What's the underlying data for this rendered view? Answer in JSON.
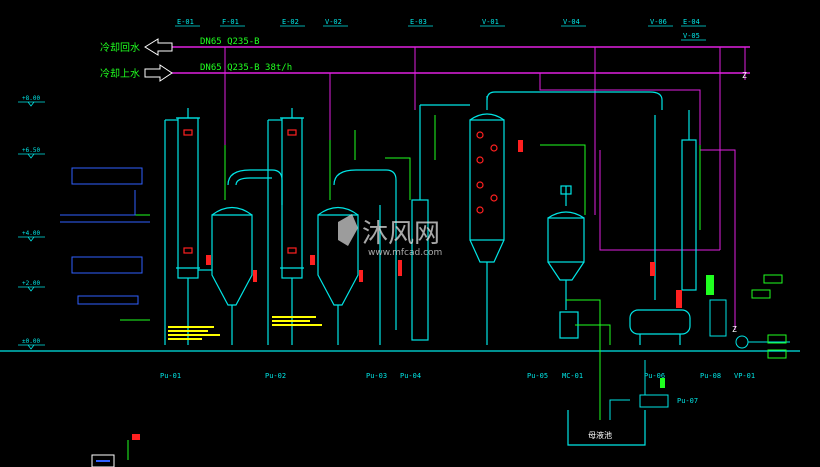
{
  "pipes": {
    "cooling_return": "冷却回水",
    "cooling_supply": "冷却上水",
    "return_spec": "DN65  Q235-B",
    "supply_spec": "DN65  Q235-B  38t/h"
  },
  "tags_top": [
    "E-01",
    "F-01",
    "E-02",
    "V-02",
    "E-03",
    "V-01",
    "V-04",
    "V-06",
    "E-04",
    "V-05"
  ],
  "tags_bottom": [
    "Pu-01",
    "Pu-02",
    "Pu-03",
    "Pu-04",
    "Pu-05",
    "MC-01",
    "Pu-06",
    "Pu-07",
    "Pu-08",
    "VP-01"
  ],
  "level_marks": [
    "+8.00",
    "+6.50",
    "+4.00",
    "+2.00",
    "±0.00"
  ],
  "tank_label": "母液池",
  "watermark": {
    "brand": "沐风网",
    "url": "www.mfcad.com"
  },
  "colors": {
    "background": "#000000",
    "cooling_pipe": "#e020e0",
    "process": "#00e5e5",
    "instrument": "#20ff20",
    "accent_red": "#ff2020",
    "hatch_yellow": "#ffff00",
    "blue": "#3060ff",
    "white": "#ffffff"
  }
}
